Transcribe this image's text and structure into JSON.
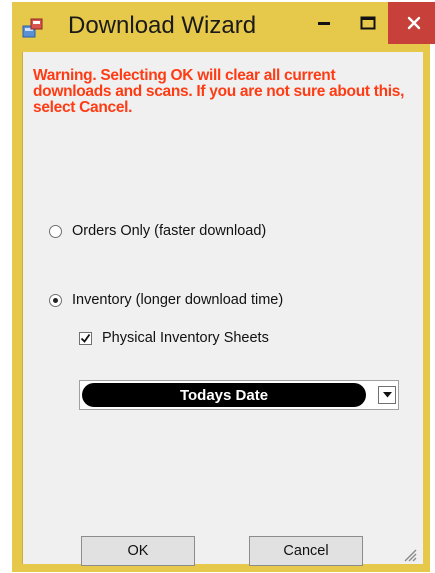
{
  "window": {
    "title": "Download Wizard",
    "icon": "download-wizard-app-icon",
    "controls": {
      "minimize": "minimize-icon",
      "maximize": "maximize-icon",
      "close": "close-icon"
    },
    "frame_color": "#e6c84a",
    "close_color": "#c7413a"
  },
  "warning": {
    "text": "Warning. Selecting OK will clear all current downloads and scans. If you are not sure about this, select Cancel.",
    "color": "#ff3b14"
  },
  "options": {
    "orders_only": {
      "label": "Orders Only (faster download)",
      "checked": false
    },
    "inventory": {
      "label": "Inventory (longer download time)",
      "checked": true
    },
    "physical_sheets": {
      "label": "Physical Inventory Sheets",
      "checked": true
    }
  },
  "date_select": {
    "selected": "Todays Date"
  },
  "buttons": {
    "ok": "OK",
    "cancel": "Cancel"
  }
}
